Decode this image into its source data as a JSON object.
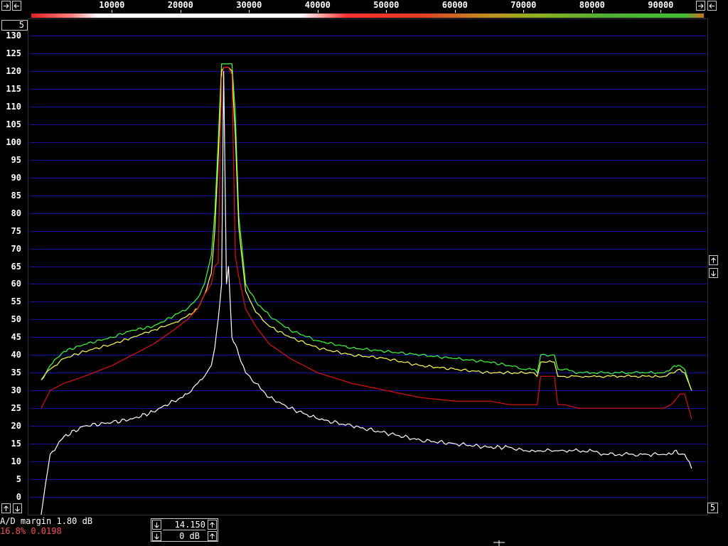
{
  "frequency_axis": {
    "ticks": [
      "10000",
      "20000",
      "30000",
      "40000",
      "50000",
      "60000",
      "70000",
      "80000",
      "90000"
    ],
    "range": [
      -1950,
      96700
    ]
  },
  "level_axis": {
    "ticks": [
      "130",
      "125",
      "120",
      "115",
      "110",
      "105",
      "100",
      "95",
      "90",
      "85",
      "80",
      "75",
      "70",
      "65",
      "60",
      "55",
      "50",
      "45",
      "40",
      "35",
      "30",
      "25",
      "20",
      "15",
      "10",
      "5",
      "0"
    ],
    "range_db": [
      -5,
      132
    ]
  },
  "top_left_field": "5",
  "bottom_right_field": "5",
  "status": {
    "ad_margin": "A/D margin 1.80 dB",
    "cpu_load": "16.8% 0.0198"
  },
  "controls": {
    "top_value": "14.150",
    "bottom_value": "0 dB"
  },
  "colors": {
    "background": "#000000",
    "grid": "#1414a0",
    "curve_green": "#3cff3c",
    "curve_yellow": "#ffff50",
    "curve_red": "#e01010",
    "curve_white": "#ffffff",
    "text_red": "#ff5050"
  },
  "icons": [
    "arrow-right-icon",
    "arrow-left-icon",
    "arrow-up-icon",
    "arrow-down-icon"
  ],
  "chart_data": {
    "type": "line",
    "x": [
      -300,
      1000,
      3000,
      6000,
      10000,
      13000,
      16000,
      19000,
      21000,
      22500,
      23500,
      24500,
      25000,
      25500,
      26000,
      26300,
      26700,
      27000,
      27500,
      28000,
      28500,
      29500,
      31000,
      33000,
      36000,
      40000,
      45000,
      50000,
      55000,
      60000,
      65000,
      68000,
      70000,
      71500,
      72000,
      72500,
      74500,
      75000,
      76000,
      78000,
      80000,
      82000,
      84000,
      86000,
      88000,
      89500,
      90500,
      91500,
      92000,
      92800,
      93500,
      94500
    ],
    "series": [
      {
        "values": [
          33,
          37,
          41,
          43,
          45,
          47,
          48,
          51,
          53,
          56,
          60,
          68,
          80,
          100,
          122,
          122,
          122,
          122,
          122,
          108,
          79,
          60,
          55,
          51,
          47,
          44,
          42,
          41,
          40,
          39,
          38,
          37,
          36,
          36,
          35,
          40,
          40,
          36,
          36,
          35,
          35,
          35,
          35,
          35,
          35,
          35,
          35,
          36,
          37,
          37,
          36,
          30
        ]
      },
      {
        "values": [
          33,
          36,
          39,
          41,
          43,
          45,
          47,
          49,
          51,
          53,
          57,
          63,
          75,
          95,
          120,
          121,
          121,
          121,
          120,
          102,
          76,
          58,
          52,
          48,
          45,
          42,
          40,
          39,
          37,
          36,
          35,
          35,
          35,
          35,
          34,
          38,
          38,
          34,
          34,
          34,
          34,
          34,
          34,
          34,
          34,
          34,
          34,
          35,
          35,
          36,
          35,
          30
        ]
      },
      {
        "values": [
          25,
          30,
          32,
          34,
          37,
          40,
          43,
          47,
          50,
          53,
          57,
          60,
          65,
          66,
          118,
          121,
          121,
          121,
          119,
          68,
          62,
          53,
          48,
          43,
          39,
          35,
          32,
          30,
          28,
          27,
          27,
          26,
          26,
          26,
          26,
          34,
          34,
          26,
          26,
          25,
          25,
          25,
          25,
          25,
          25,
          25,
          25,
          26,
          27,
          29,
          29,
          22
        ]
      },
      {
        "values": [
          -5,
          12,
          17,
          20,
          21,
          22,
          24,
          27,
          29,
          32,
          34,
          37,
          42,
          50,
          60,
          120,
          60,
          65,
          45,
          43,
          40,
          35,
          32,
          28,
          25,
          22,
          20,
          18,
          16,
          15,
          14,
          14,
          13,
          13,
          13,
          13,
          13,
          13,
          13,
          13,
          13,
          12,
          12,
          12,
          12,
          12,
          12,
          12,
          13,
          12,
          12,
          8
        ]
      }
    ]
  }
}
